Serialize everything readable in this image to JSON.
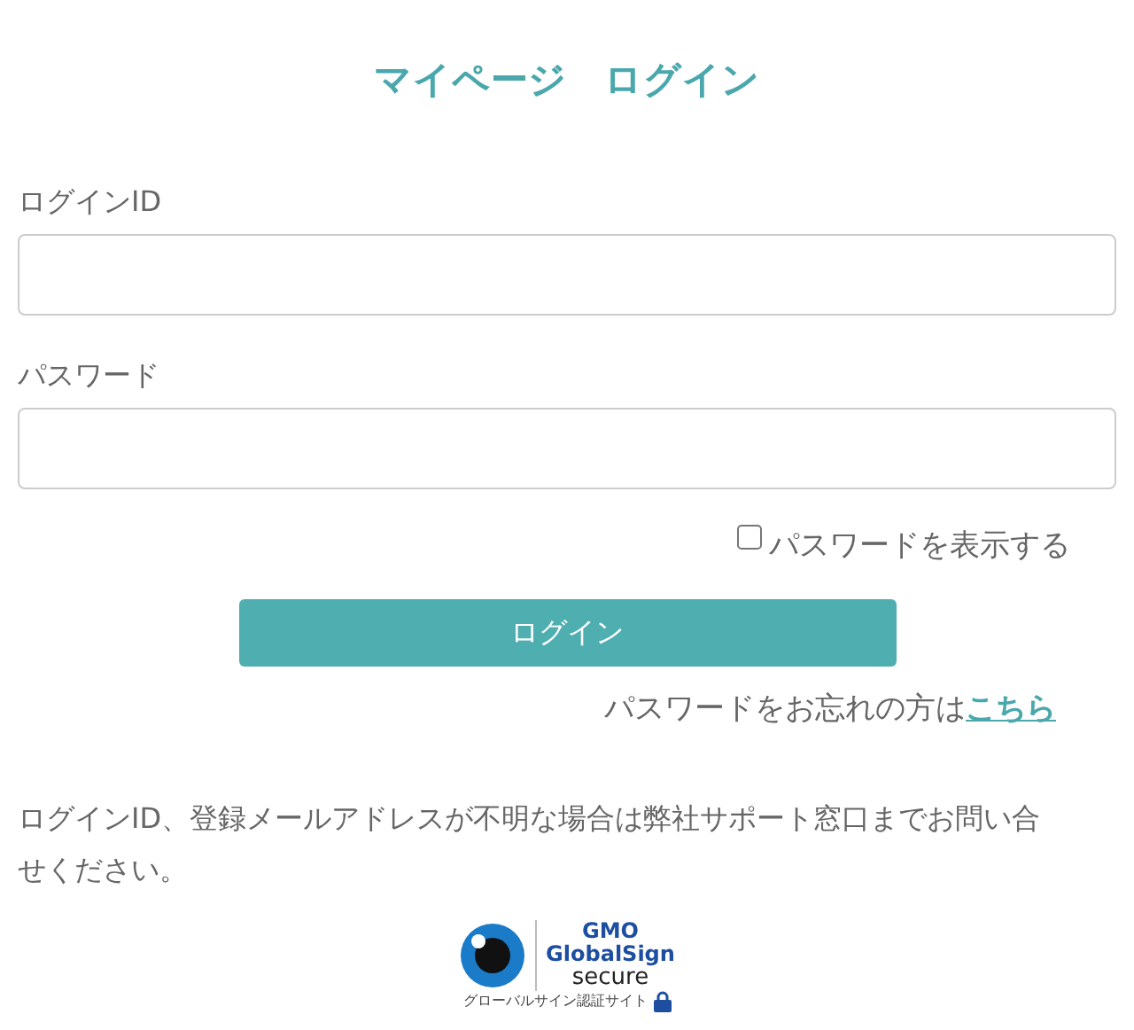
{
  "title": "マイページ　ログイン",
  "fields": [
    {
      "label": "ログインID"
    },
    {
      "label": "パスワード"
    }
  ],
  "show_password": {
    "label": "パスワードを表示する",
    "checked": false
  },
  "login_button": "ログイン",
  "forgot": {
    "text": "パスワードをお忘れの方は",
    "link": "こちら"
  },
  "note": "ログインID、登録メールアドレスが不明な場合は弊社サポート窓口までお問い合せください。",
  "seal": {
    "brand": "GMO",
    "name": "GlobalSign",
    "tag": "secure",
    "caption": "グローバルサイン認証サイト"
  }
}
